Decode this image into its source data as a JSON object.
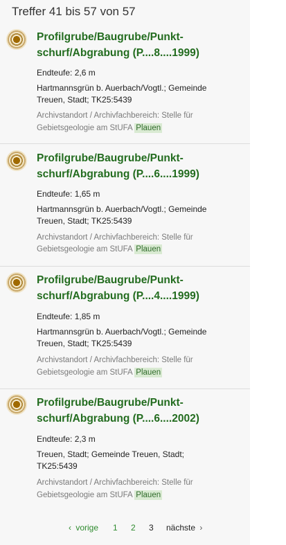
{
  "header": {
    "results_label": "Treffer 41 bis 57 von 57"
  },
  "results": [
    {
      "title_line1": "Profilgrube/Baugrube/Punkt-",
      "title_line2": "schurf/Abgrabung (P....8....1999)",
      "depth": "Endteufe: 2,6 m",
      "location_line1": "Hartmannsgrün b. Auerbach/Vogtl.; Gemeinde",
      "location_line2": "Treuen, Stadt; TK25:5439",
      "archive_line1": "Archivstandort / Archivfachbereich: Stelle für",
      "archive_line2": "Gebietsgeologie am StUFA",
      "archive_highlight": "Plauen"
    },
    {
      "title_line1": "Profilgrube/Baugrube/Punkt-",
      "title_line2": "schurf/Abgrabung (P....6....1999)",
      "depth": "Endteufe: 1,65 m",
      "location_line1": "Hartmannsgrün b. Auerbach/Vogtl.; Gemeinde",
      "location_line2": "Treuen, Stadt; TK25:5439",
      "archive_line1": "Archivstandort / Archivfachbereich: Stelle für",
      "archive_line2": "Gebietsgeologie am StUFA",
      "archive_highlight": "Plauen"
    },
    {
      "title_line1": "Profilgrube/Baugrube/Punkt-",
      "title_line2": "schurf/Abgrabung (P....4....1999)",
      "depth": "Endteufe: 1,85 m",
      "location_line1": "Hartmannsgrün b. Auerbach/Vogtl.; Gemeinde",
      "location_line2": "Treuen, Stadt; TK25:5439",
      "archive_line1": "Archivstandort / Archivfachbereich: Stelle für",
      "archive_line2": "Gebietsgeologie am StUFA",
      "archive_highlight": "Plauen"
    },
    {
      "title_line1": "Profilgrube/Baugrube/Punkt-",
      "title_line2": "schurf/Abgrabung (P....6....2002)",
      "depth": "Endteufe: 2,3 m",
      "location_line1": "Treuen, Stadt; Gemeinde Treuen, Stadt;",
      "location_line2": "TK25:5439",
      "archive_line1": "Archivstandort / Archivfachbereich: Stelle für",
      "archive_line2": "Gebietsgeologie am StUFA",
      "archive_highlight": "Plauen"
    }
  ],
  "pagination": {
    "prev_label": "vorige",
    "pages": [
      "1",
      "2",
      "3"
    ],
    "current_page": "3",
    "next_label": "nächste"
  },
  "colors": {
    "title_green": "#236c1f",
    "link_green": "#2d8a2d",
    "highlight_bg": "#d9ead2",
    "marker_brown": "#a06a00"
  },
  "icons": [
    "location-marker-icon",
    "chevron-left-icon",
    "chevron-right-icon"
  ]
}
